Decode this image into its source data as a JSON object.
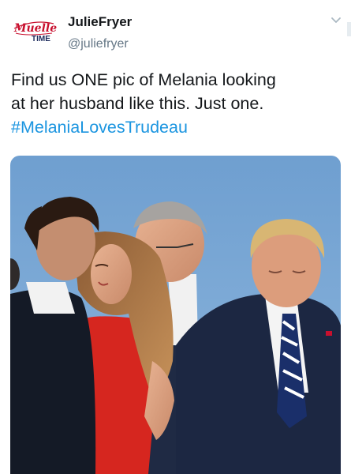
{
  "tweet": {
    "display_name": "JulieFryer",
    "handle": "@juliefryer",
    "avatar_logo_text": "Mueller TIME",
    "text_line_1": "Find us ONE pic of Melania looking",
    "text_line_2": "at her husband like this. Just one.",
    "hashtag": "#MelaniaLovesTrudeau"
  },
  "colors": {
    "text": "#14171a",
    "secondary": "#657786",
    "link": "#1b95e0",
    "logo_red": "#c8102e",
    "logo_navy": "#1c2a5c"
  },
  "icons": {
    "caret": "chevron-down-icon"
  },
  "media": {
    "type": "photo",
    "description_visible": false
  }
}
